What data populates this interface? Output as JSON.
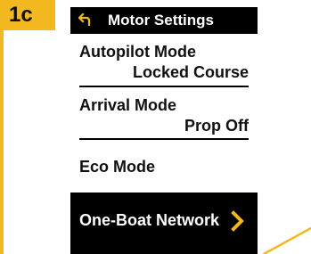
{
  "step": {
    "label": "1c"
  },
  "header": {
    "title": "Motor Settings",
    "back_icon": "back-arrow-icon"
  },
  "settings": [
    {
      "label": "Autopilot Mode",
      "value": "Locked Course"
    },
    {
      "label": "Arrival Mode",
      "value": "Prop Off"
    },
    {
      "label": "Eco Mode",
      "value": ""
    }
  ],
  "network": {
    "label": "One-Boat Network",
    "icon": "chevron-right-icon"
  },
  "colors": {
    "accent": "#f3b81f",
    "screen_bg": "#ffffff",
    "header_bg": "#000000",
    "selected_bg": "#000000",
    "chevron": "#f3b81f"
  }
}
